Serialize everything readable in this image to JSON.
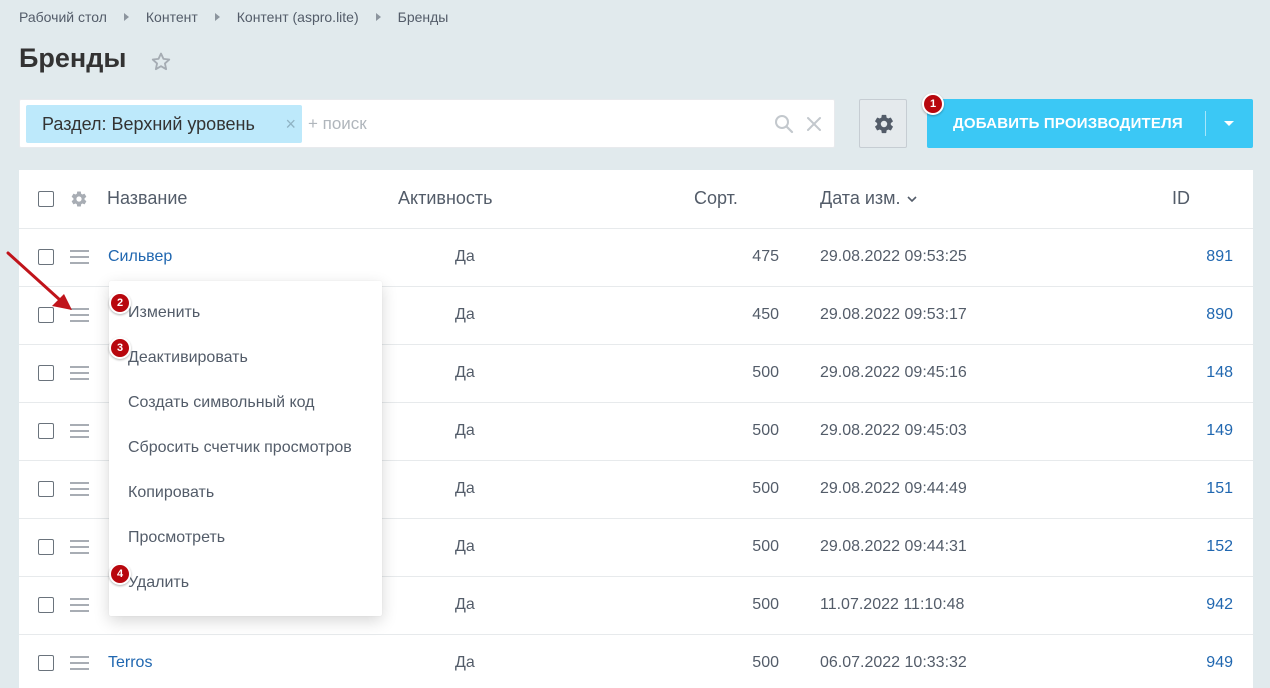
{
  "breadcrumbs": [
    "Рабочий стол",
    "Контент",
    "Контент (aspro.lite)",
    "Бренды"
  ],
  "page": {
    "title": "Бренды"
  },
  "filter": {
    "chip_label": "Раздел: Верхний уровень",
    "chip_close": "×",
    "search_placeholder": "+ поиск"
  },
  "toolbar": {
    "add_label": "ДОБАВИТЬ ПРОИЗВОДИТЕЛЯ"
  },
  "table": {
    "columns": {
      "name": "Название",
      "active": "Активность",
      "sort": "Сорт.",
      "date": "Дата изм.",
      "id": "ID"
    },
    "rows": [
      {
        "name": "Сильвер",
        "active": "Да",
        "sort": "475",
        "date": "29.08.2022 09:53:25",
        "id": "891"
      },
      {
        "name": "",
        "active": "Да",
        "sort": "450",
        "date": "29.08.2022 09:53:17",
        "id": "890"
      },
      {
        "name": "",
        "active": "Да",
        "sort": "500",
        "date": "29.08.2022 09:45:16",
        "id": "148"
      },
      {
        "name": "",
        "active": "Да",
        "sort": "500",
        "date": "29.08.2022 09:45:03",
        "id": "149"
      },
      {
        "name": "",
        "active": "Да",
        "sort": "500",
        "date": "29.08.2022 09:44:49",
        "id": "151"
      },
      {
        "name": "",
        "active": "Да",
        "sort": "500",
        "date": "29.08.2022 09:44:31",
        "id": "152"
      },
      {
        "name": "",
        "active": "Да",
        "sort": "500",
        "date": "11.07.2022 11:10:48",
        "id": "942"
      },
      {
        "name": "Terros",
        "active": "Да",
        "sort": "500",
        "date": "06.07.2022 10:33:32",
        "id": "949"
      }
    ]
  },
  "context_menu": {
    "items": [
      "Изменить",
      "Деактивировать",
      "Создать символьный код",
      "Сбросить счетчик просмотров",
      "Копировать",
      "Просмотреть",
      "Удалить"
    ]
  },
  "badges": [
    "1",
    "2",
    "3",
    "4"
  ],
  "colors": {
    "accent": "#3bc8f5",
    "link": "#2067b0",
    "badge": "#b8070e",
    "chip": "#bde9fb"
  }
}
